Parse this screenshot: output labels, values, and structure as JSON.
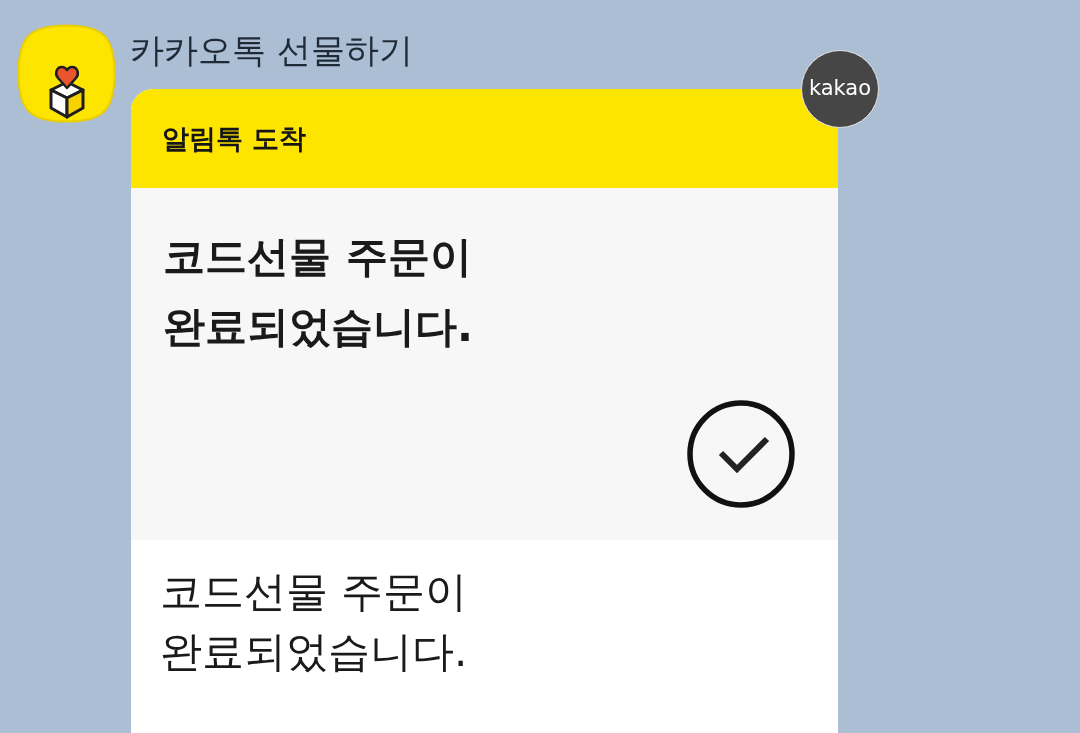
{
  "sender": {
    "name": "카카오톡 선물하기"
  },
  "message": {
    "badge": "kakao",
    "header": "알림톡 도착",
    "headline": "코드선물 주문이\n완료되었습니다.",
    "body": "코드선물 주문이\n완료되었습니다."
  }
}
